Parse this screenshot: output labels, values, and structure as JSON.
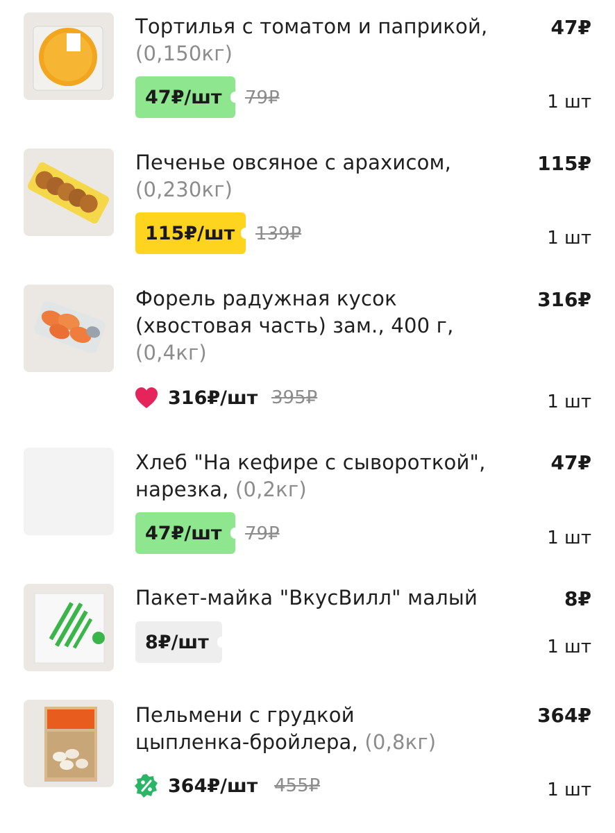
{
  "items": [
    {
      "name": "Тортилья с томатом и паприкой,",
      "weight": "(0,150кг)",
      "total": "47₽",
      "unit_price": "47₽/шт",
      "old_price": "79₽",
      "qty": "1 шт",
      "badge_color": "#8ee68e",
      "thumb": "tortilla-image"
    },
    {
      "name": "Печенье овсяное с арахисом,",
      "weight": "(0,230кг)",
      "total": "115₽",
      "unit_price": "115₽/шт",
      "old_price": "139₽",
      "qty": "1 шт",
      "badge_color": "#ffd41f",
      "thumb": "cookies-image"
    },
    {
      "name_line1": "Форель радужная кусок",
      "name_line2": "(хвостовая часть) зам., 400 г,",
      "weight": "(0,4кг)",
      "total": "316₽",
      "unit_price": "316₽/шт",
      "old_price": "395₽",
      "qty": "1 шт",
      "icon": "heart-icon",
      "icon_color": "#e4245a",
      "thumb": "trout-image"
    },
    {
      "name_line1": "Хлеб \"На кефире с сывороткой\",",
      "name_line2": "нарезка,",
      "weight": "(0,2кг)",
      "total": "47₽",
      "unit_price": "47₽/шт",
      "old_price": "79₽",
      "qty": "1 шт",
      "badge_color": "#8ee68e",
      "thumb": "bread-image-placeholder"
    },
    {
      "name": "Пакет-майка \"ВкусВилл\" малый",
      "total": "8₽",
      "unit_price": "8₽/шт",
      "qty": "1 шт",
      "badge_color": "#eeeeee",
      "thumb": "bag-image"
    },
    {
      "name_line1": "Пельмени с грудкой",
      "name_line2": "цыпленка-бройлера,",
      "weight": "(0,8кг)",
      "total": "364₽",
      "unit_price": "364₽/шт",
      "old_price": "455₽",
      "qty": "1 шт",
      "icon": "discount-percent-icon",
      "icon_color": "#2bb566",
      "thumb": "dumplings-image"
    }
  ]
}
